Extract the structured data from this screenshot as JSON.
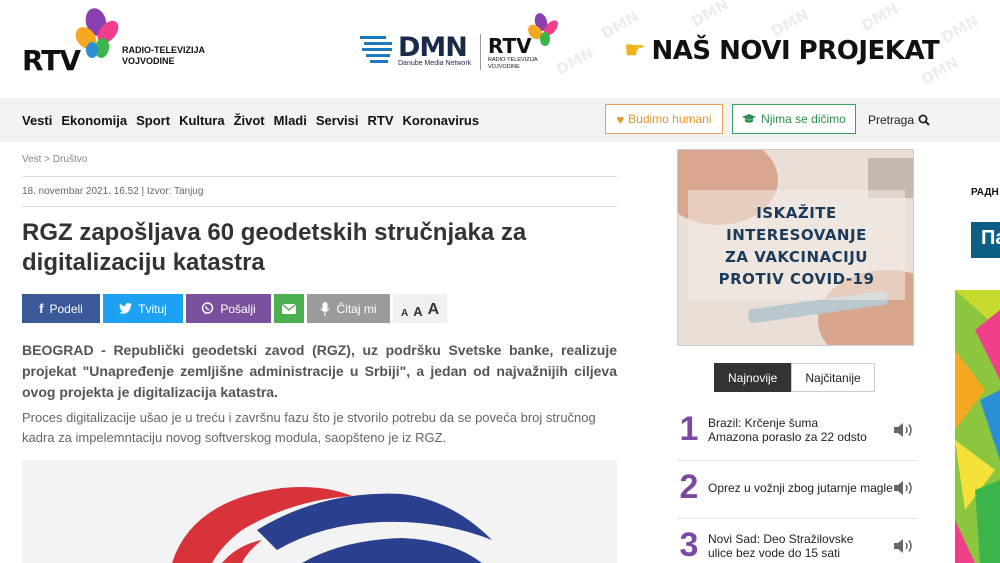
{
  "header": {
    "logo_text": "RTV",
    "logo_sub_1": "RADIO-TELEVIZIJA",
    "logo_sub_2": "VOJVODINE",
    "dmn_text": "DMN",
    "dmn_sub": "Danube Media Network",
    "rtv2_text": "RTV",
    "rtv2_sub_1": "RADIO-TELEVIZIJA",
    "rtv2_sub_2": "VOJVODINE",
    "promo_text": "NAŠ NOVI PROJEKAT",
    "watermark": "DMN"
  },
  "nav": {
    "items": [
      "Vesti",
      "Ekonomija",
      "Sport",
      "Kultura",
      "Život",
      "Mladi",
      "Servisi",
      "RTV",
      "Koronavirus"
    ],
    "humani_label": "Budimo humani",
    "dicimo_label": "Njima se dičimo",
    "search_label": "Pretraga"
  },
  "article": {
    "breadcrumb": "Vest > Društvo",
    "meta": "18. novembar  2021. 16.52  |  Izvor: Tanjug",
    "title": "RGZ zapošljava 60 geodetskih stručnjaka za digitalizaciju katastra",
    "share": {
      "facebook": "Podeli",
      "twitter": "Tvituj",
      "viber": "Pošalji",
      "read": "Čitaj mi"
    },
    "font_sizes": [
      "A",
      "A",
      "A"
    ],
    "lead": "BEOGRAD - Republički geodetski zavod (RGZ), uz podršku Svetske banke, realizuje projekat \"Unapređenje zemljišne administracije u Srbiji\", a jedan od najvažnijih ciljeva ovog projekta je digitalizacija katastra.",
    "body": "Proces digitalizacije ušao je u treću i završnu fazu što je stvorilo potrebu da se poveća broj stručnog kadra za impelemntaciju novog softverskog modula, saopšteno je iz RGZ."
  },
  "sidebar": {
    "ad_lines": [
      "ISKAŽITE",
      "INTERESOVANJE",
      "ZA VAKCINACIJU",
      "PROTIV COVID-19"
    ],
    "tab_newest": "Najnovije",
    "tab_most_read": "Najčitanije",
    "news": [
      {
        "num": "1",
        "text": "Brazil: Krčenje šuma Amazona poraslo za 22 odsto"
      },
      {
        "num": "2",
        "text": "Oprez u vožnji zbog jutarnje magle"
      },
      {
        "num": "3",
        "text": "Novi Sad: Deo Stražilovske ulice bez vode do 15 sati"
      }
    ]
  },
  "edge": {
    "text": "РАДН",
    "box": "Па"
  },
  "colors": {
    "facebook": "#3b5998",
    "twitter": "#1da1f2",
    "viber": "#7b519d",
    "email": "#4caf50",
    "read": "#9b9b9b",
    "number_purple": "#7b4aa0",
    "humani_orange": "#e6942a",
    "dicimo_green": "#2f8f50"
  }
}
